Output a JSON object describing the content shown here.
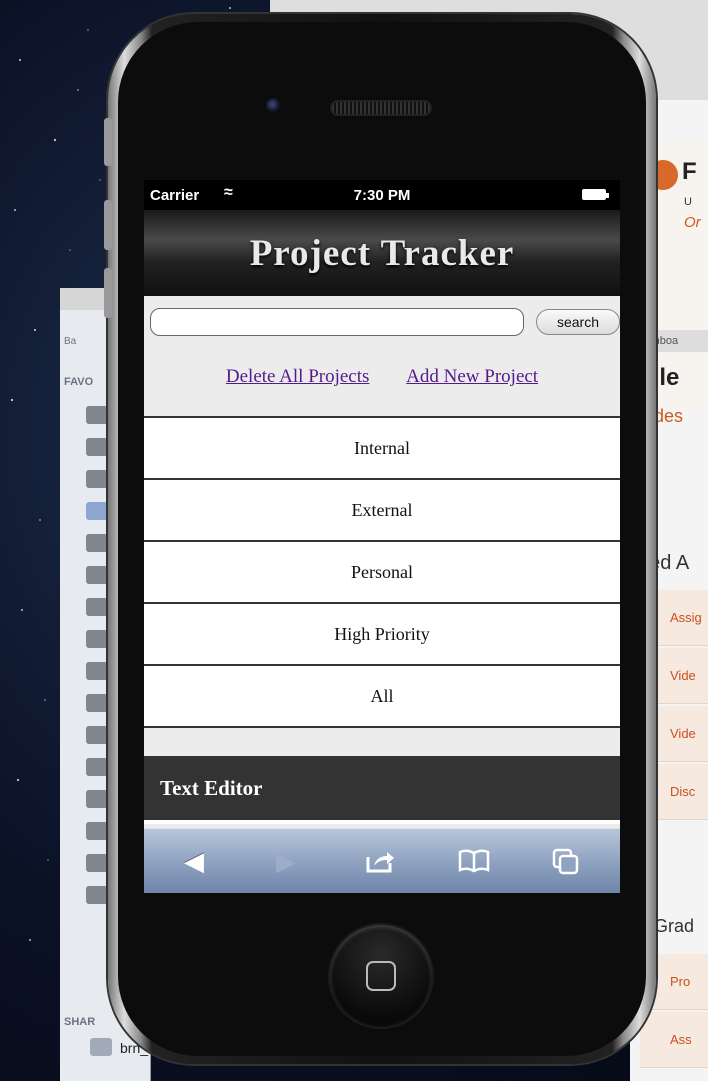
{
  "status_bar": {
    "carrier": "Carrier",
    "time": "7:30 PM"
  },
  "app": {
    "title": "Project Tracker"
  },
  "search": {
    "placeholder": "",
    "button_label": "search"
  },
  "actions": {
    "delete_all": "Delete All Projects",
    "add_new": "Add New Project"
  },
  "projects": [
    {
      "label": "Internal"
    },
    {
      "label": "External"
    },
    {
      "label": "Personal"
    },
    {
      "label": "High Priority"
    },
    {
      "label": "All"
    }
  ],
  "footer": {
    "label": "Text Editor"
  },
  "toolbar": {
    "icons": [
      "back-arrow-icon",
      "forward-arrow-icon",
      "share-icon",
      "bookmarks-icon",
      "tabs-icon"
    ]
  },
  "background": {
    "browser_partial": {
      "letter": "F",
      "line1": "U",
      "line2": "Or",
      "dashboard": "ashboa",
      "heading": "bile",
      "subheading": "rades",
      "section": "ded A",
      "rows": [
        "Assig",
        "Vide",
        "Vide",
        "Disc"
      ],
      "grades": "Grad",
      "rows2": [
        "Pro",
        "Ass"
      ]
    },
    "finder_partial": {
      "favorites": "FAVO",
      "shared": "SHAR",
      "device": "brn_",
      "back": "Ba"
    }
  },
  "colors": {
    "link": "#551a8b",
    "footer": "#333333",
    "toolbar": "#8fa3c1"
  }
}
